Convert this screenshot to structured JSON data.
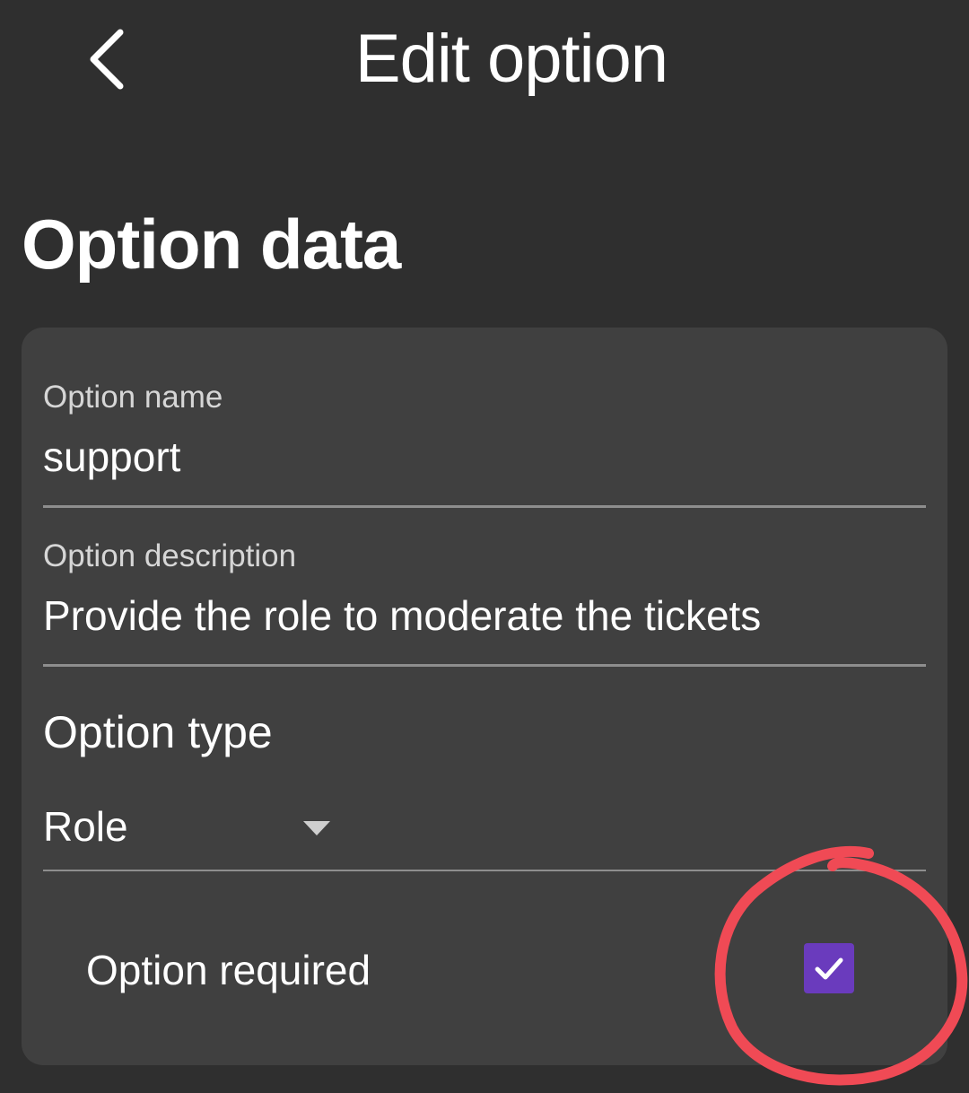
{
  "header": {
    "back_icon": "chevron-left-icon",
    "title": "Edit option"
  },
  "section": {
    "title": "Option data"
  },
  "form": {
    "name": {
      "label": "Option name",
      "value": "support"
    },
    "description": {
      "label": "Option description",
      "value": "Provide the role to moderate the tickets"
    },
    "type": {
      "label": "Option type",
      "selected": "Role",
      "caret_icon": "caret-down-icon"
    },
    "required": {
      "label": "Option required",
      "checked": true,
      "check_icon": "check-icon"
    }
  },
  "colors": {
    "background": "#2f2f2f",
    "card": "#404040",
    "checkbox_accent": "#6a3bbd",
    "annotation_circle": "#f04a55"
  }
}
